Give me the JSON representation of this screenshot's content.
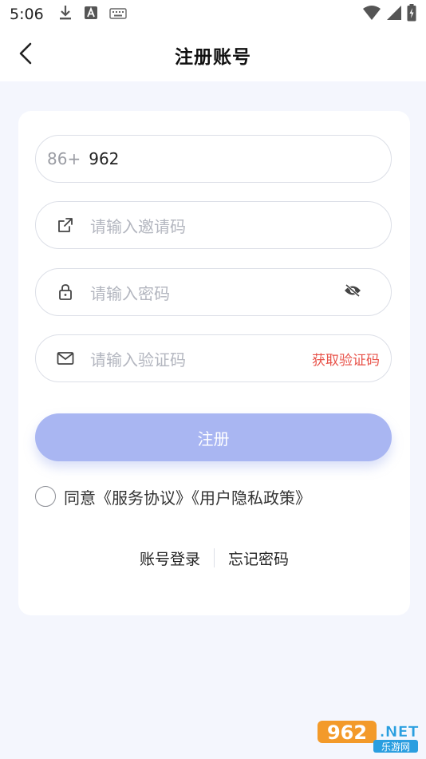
{
  "status_bar": {
    "time": "5:06",
    "icons_left": [
      "download-icon",
      "font-a-icon",
      "keyboard-icon"
    ],
    "icons_right": [
      "wifi-icon",
      "cellular-signal-icon",
      "battery-charging-icon"
    ]
  },
  "header": {
    "title": "注册账号",
    "back_icon": "chevron-left-icon"
  },
  "form": {
    "phone": {
      "country_code": "86+",
      "value": "962"
    },
    "invite": {
      "icon": "external-link-icon",
      "placeholder": "请输入邀请码"
    },
    "password": {
      "icon": "lock-icon",
      "placeholder": "请输入密码",
      "toggle_icon": "eye-off-icon"
    },
    "verify": {
      "icon": "mail-icon",
      "placeholder": "请输入验证码",
      "get_code_label": "获取验证码"
    },
    "submit_label": "注册",
    "agreement": {
      "prefix": "同意",
      "service_link": "《服务协议》",
      "privacy_link": "《用户隐私政策》"
    }
  },
  "links": {
    "account_login": "账号登录",
    "forgot_password": "忘记密码"
  },
  "watermark": {
    "brand": "962",
    "suffix": ".NET",
    "sub": "乐游网"
  },
  "colors": {
    "accent": "#a9b6f2",
    "get_code": "#e8534a",
    "background": "#f4f6fd",
    "card": "#ffffff"
  }
}
